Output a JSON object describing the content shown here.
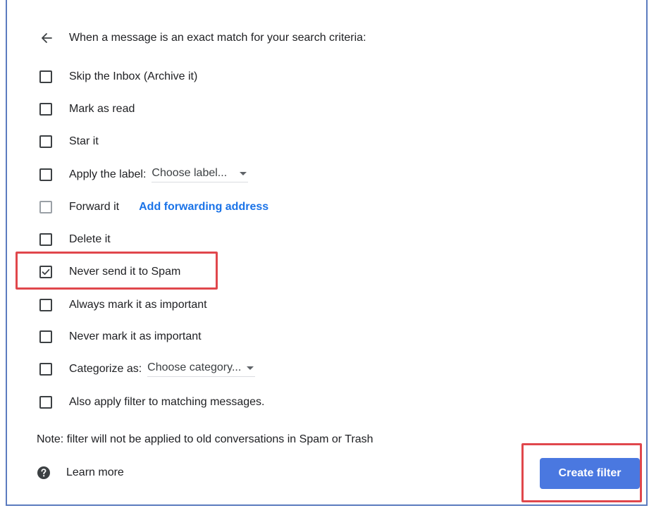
{
  "header": {
    "text": "When a message is an exact match for your search criteria:"
  },
  "options": [
    {
      "label": "Skip the Inbox (Archive it)",
      "checked": false
    },
    {
      "label": "Mark as read",
      "checked": false
    },
    {
      "label": "Star it",
      "checked": false
    },
    {
      "label": "Apply the label:",
      "checked": false,
      "select": "Choose label..."
    },
    {
      "label": "Forward it",
      "checked": false,
      "disabled": true,
      "link": "Add forwarding address"
    },
    {
      "label": "Delete it",
      "checked": false
    },
    {
      "label": "Never send it to Spam",
      "checked": true
    },
    {
      "label": "Always mark it as important",
      "checked": false
    },
    {
      "label": "Never mark it as important",
      "checked": false
    },
    {
      "label": "Categorize as:",
      "checked": false,
      "select": "Choose category..."
    },
    {
      "label": "Also apply filter to matching messages.",
      "checked": false
    }
  ],
  "note": "Note: filter will not be applied to old conversations in Spam or Trash",
  "learn_more": "Learn more",
  "create_button": "Create filter",
  "colors": {
    "accent": "#1a73e8",
    "button": "#4a78e0",
    "highlight": "#e0474c",
    "frame": "#5b7bbf"
  },
  "icons": {
    "back": "arrow-left-icon",
    "help": "help-circle-icon",
    "check": "check-icon",
    "dropdown": "caret-down-icon"
  }
}
